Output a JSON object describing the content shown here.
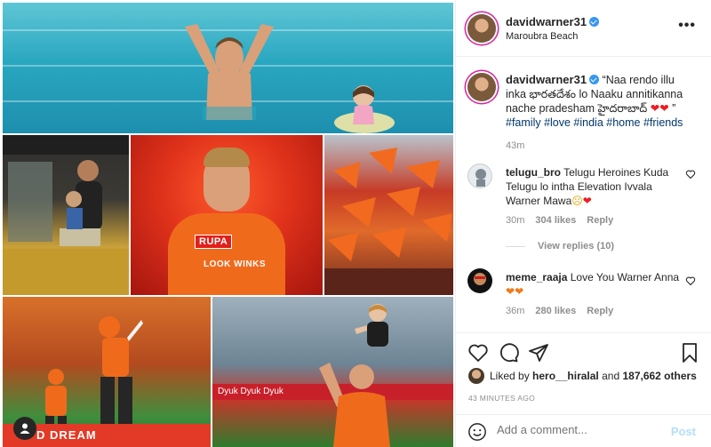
{
  "post": {
    "username": "davidwarner31",
    "location": "Maroubra Beach",
    "more_label": "•••",
    "caption": {
      "text": "“Naa rendo illu inka భారతదేశం lo Naaku annitikanna nache pradesham హైదరాబాద్ ",
      "end_quote": "”",
      "hashtags": "#family #love #india #home #friends",
      "time": "43m"
    }
  },
  "comments": [
    {
      "username": "telugu_bro",
      "text": "Telugu Heroines Kuda Telugu lo intha Elevation Ivvala Warner Mawa",
      "emoji": "☹",
      "time": "30m",
      "likes": "304 likes",
      "reply": "Reply",
      "view_replies": "View replies (10)"
    },
    {
      "username": "meme_raaja",
      "text": "Love You Warner Anna",
      "time": "36m",
      "likes": "280 likes",
      "reply": "Reply"
    }
  ],
  "likes": {
    "prefix": "Liked by ",
    "user": "hero__hiralal",
    "middle": " and ",
    "count": "187,662 others"
  },
  "posted": "43 MINUTES AGO",
  "add_comment": {
    "placeholder": "Add a comment...",
    "post_label": "Post"
  },
  "collage_text": {
    "sponsor1": "RUPA",
    "sponsor2": "LOOK WINKS",
    "board1": "D DREAM",
    "board2": "Dyuk Dyuk Dyuk"
  },
  "colors": {
    "verified": "#3897f0",
    "hashtag": "#00376b",
    "heart": "#ed1c24",
    "post_button": "#b2dffc",
    "srh_orange": "#f06a1c"
  },
  "icons": [
    "verified-icon",
    "more-icon",
    "heart-icon",
    "comment-icon",
    "share-icon",
    "bookmark-icon",
    "smile-icon",
    "user-tag-icon"
  ]
}
